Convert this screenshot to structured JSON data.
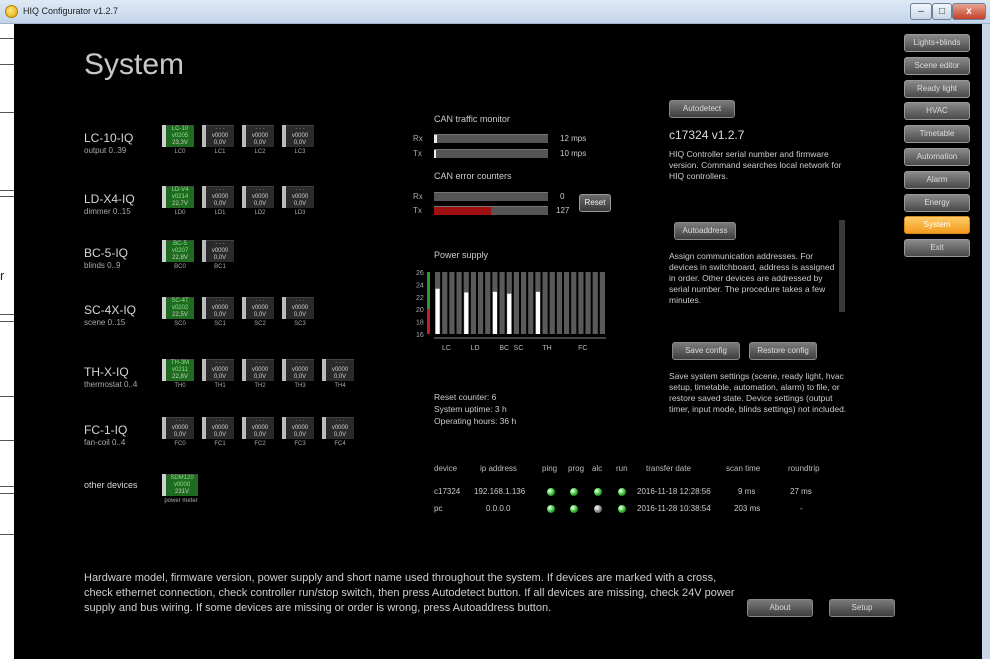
{
  "window": {
    "title": "HIQ Configurator v1.2.7",
    "minimize": "–",
    "maximize": "□",
    "close": "x"
  },
  "frame": {
    "letter": "r"
  },
  "page": {
    "title": "System"
  },
  "device_rows": [
    {
      "name": "LC-10-IQ",
      "sub": "output 0..39",
      "devices": [
        {
          "l1": "LC-10",
          "l2": "v0205",
          "l3": "23,3V",
          "n": "LC0",
          "present": true
        },
        {
          "l1": "- - -",
          "l2": "v0000",
          "l3": "0,0V",
          "n": "LC1",
          "present": false
        },
        {
          "l1": "- - -",
          "l2": "v0000",
          "l3": "0,0V",
          "n": "LC2",
          "present": false
        },
        {
          "l1": "- - -",
          "l2": "v0000",
          "l3": "0,0V",
          "n": "LC3",
          "present": false
        }
      ]
    },
    {
      "name": "LD-X4-IQ",
      "sub": "dimmer 0..15",
      "devices": [
        {
          "l1": "LD-V4",
          "l2": "v0214",
          "l3": "22,7V",
          "n": "LD0",
          "present": true
        },
        {
          "l1": "- - -",
          "l2": "v0000",
          "l3": "0,0V",
          "n": "LD1",
          "present": false
        },
        {
          "l1": "- - -",
          "l2": "v0000",
          "l3": "0,0V",
          "n": "LD2",
          "present": false
        },
        {
          "l1": "- - -",
          "l2": "v0000",
          "l3": "0,0V",
          "n": "LD3",
          "present": false
        }
      ]
    },
    {
      "name": "BC-5-IQ",
      "sub": "blinds 0..9",
      "devices": [
        {
          "l1": "BC-5",
          "l2": "v0207",
          "l3": "22,8V",
          "n": "BC0",
          "present": true
        },
        {
          "l1": "- - -",
          "l2": "v0000",
          "l3": "0,0V",
          "n": "BC1",
          "present": false
        }
      ]
    },
    {
      "name": "SC-4X-IQ",
      "sub": "scene 0..15",
      "devices": [
        {
          "l1": "SC-4T",
          "l2": "v0202",
          "l3": "22,5V",
          "n": "SC0",
          "present": true
        },
        {
          "l1": "- - -",
          "l2": "v0000",
          "l3": "0,0V",
          "n": "SC1",
          "present": false
        },
        {
          "l1": "- - -",
          "l2": "v0000",
          "l3": "0,0V",
          "n": "SC2",
          "present": false
        },
        {
          "l1": "- - -",
          "l2": "v0000",
          "l3": "0,0V",
          "n": "SC3",
          "present": false
        }
      ]
    },
    {
      "name": "TH-X-IQ",
      "sub": "thermostat 0..4",
      "devices": [
        {
          "l1": "TH-3M",
          "l2": "v0211",
          "l3": "22,8V",
          "n": "TH0",
          "present": true
        },
        {
          "l1": "- - -",
          "l2": "v0000",
          "l3": "0,0V",
          "n": "TH1",
          "present": false
        },
        {
          "l1": "- - -",
          "l2": "v0000",
          "l3": "0,0V",
          "n": "TH2",
          "present": false
        },
        {
          "l1": "- - -",
          "l2": "v0000",
          "l3": "0,0V",
          "n": "TH3",
          "present": false
        },
        {
          "l1": "- - -",
          "l2": "v0000",
          "l3": "0,0V",
          "n": "TH4",
          "present": false
        }
      ]
    },
    {
      "name": "FC-1-IQ",
      "sub": "fan-coil 0..4",
      "devices": [
        {
          "l1": "- - -",
          "l2": "v0000",
          "l3": "0,0V",
          "n": "FC0",
          "present": false
        },
        {
          "l1": "- - -",
          "l2": "v0000",
          "l3": "0,0V",
          "n": "FC1",
          "present": false
        },
        {
          "l1": "- - -",
          "l2": "v0000",
          "l3": "0,0V",
          "n": "FC2",
          "present": false
        },
        {
          "l1": "- - -",
          "l2": "v0000",
          "l3": "0,0V",
          "n": "FC3",
          "present": false
        },
        {
          "l1": "- - -",
          "l2": "v0000",
          "l3": "0,0V",
          "n": "FC4",
          "present": false
        }
      ]
    },
    {
      "name": "other devices",
      "sub": "",
      "devices": [
        {
          "l1": "SDM120",
          "l2": "v0000",
          "l3": "231V",
          "n": "power meter",
          "present": true
        }
      ]
    }
  ],
  "can_traffic": {
    "title": "CAN traffic monitor",
    "rx_label": "Rx",
    "tx_label": "Tx",
    "rx_value": "12 mps",
    "tx_value": "10 mps",
    "rx_level": 0.03,
    "tx_level": 0.02
  },
  "can_errors": {
    "title": "CAN error counters",
    "rx_label": "Rx",
    "tx_label": "Tx",
    "rx_value": "0",
    "tx_value": "127",
    "rx_level": 0,
    "tx_level": 0.5,
    "reset_label": "Reset"
  },
  "power_supply": {
    "title": "Power supply",
    "y_ticks": [
      "26",
      "24",
      "22",
      "20",
      "18",
      "16"
    ],
    "x_labels": [
      "LC",
      "LD",
      "BC",
      "SC",
      "TH",
      "FC"
    ],
    "ylim": [
      16,
      26
    ],
    "bar_count": 24,
    "bars": [
      {
        "index": 0,
        "value": 23.3
      },
      {
        "index": 4,
        "value": 22.7
      },
      {
        "index": 8,
        "value": 22.8
      },
      {
        "index": 10,
        "value": 22.5
      },
      {
        "index": 14,
        "value": 22.8
      }
    ],
    "colors": {
      "green": "#2e9a2e",
      "red": "#c81e1e",
      "bar": "#ffffff",
      "slot": "#5a5a5a"
    }
  },
  "stats": {
    "reset_counter": "Reset counter: 6",
    "uptime": "System uptime: 3 h",
    "operating_hours": "Operating hours: 36 h"
  },
  "device_table": {
    "headers": [
      "device",
      "ip address",
      "ping",
      "prog",
      "alc",
      "run",
      "transfer date",
      "scan time",
      "roundtrip"
    ],
    "rows": [
      {
        "device": "c17324",
        "ip": "192.168.1.136",
        "leds": [
          "green",
          "green",
          "green",
          "green"
        ],
        "date": "2016-11-18 12:28:56",
        "scan": "9 ms",
        "roundtrip": "27 ms"
      },
      {
        "device": "pc",
        "ip": "0.0.0.0",
        "leds": [
          "green",
          "green",
          "gray",
          "green"
        ],
        "date": "2016-11-28 10:38:54",
        "scan": "203 ms",
        "roundtrip": "-"
      }
    ]
  },
  "controller": {
    "autodetect_label": "Autodetect",
    "version": "c17324 v1.2.7",
    "version_desc": "HIQ Controller serial number and firmware version. Command searches local network for HIQ controllers.",
    "autoaddress_label": "Autoaddress",
    "autoaddress_desc": "Assign communication addresses. For devices in switchboard, address is assigned in order. Other devices are addressed by serial number. The procedure takes a few minutes.",
    "save_label": "Save config",
    "restore_label": "Restore config",
    "config_desc": "Save system settings (scene, ready light, hvac setup, timetable, automation, alarm) to file, or restore saved state. Device settings (output timer, input mode, blinds settings) not included."
  },
  "nav": {
    "items": [
      "Lights+blinds",
      "Scene editor",
      "Ready light",
      "HVAC",
      "Timetable",
      "Automation",
      "Alarm",
      "Energy",
      "System",
      "Exit"
    ],
    "active": "System"
  },
  "footer": {
    "help": "Hardware model, firmware version, power supply and short name used throughout the system. If devices are marked with a cross, check ethernet connection, check controller run/stop switch, then press Autodetect button. If all devices are missing, check 24V power supply and bus wiring. If some devices are missing or order is wrong, press Autoaddress button.",
    "about_label": "About",
    "setup_label": "Setup"
  }
}
